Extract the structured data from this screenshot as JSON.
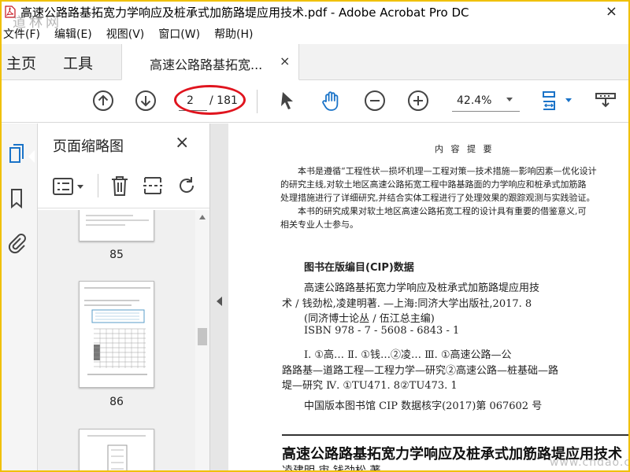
{
  "window": {
    "title": "高速公路路基拓宽力学响应及桩承式加筋路堤应用技术.pdf - Adobe Acrobat Pro DC",
    "close_glyph": "×",
    "watermark_top": "道林网",
    "watermark_bottom": "www.cndao.com"
  },
  "menu": [
    "文件(F)",
    "编辑(E)",
    "视图(V)",
    "窗口(W)",
    "帮助(H)"
  ],
  "tabs": {
    "home": "主页",
    "tools": "工具",
    "document": "高速公路路基拓宽...",
    "close": "×"
  },
  "toolbar": {
    "current_page": "2",
    "total_pages": "/ 181",
    "zoom": "42.4%",
    "highlight_color": "#e0141e",
    "accent_color": "#1a73c8"
  },
  "panel": {
    "title": "页面缩略图",
    "close": "×",
    "thumbnails": [
      {
        "label": "85"
      },
      {
        "label": "86"
      },
      {
        "label": ""
      }
    ]
  },
  "doc": {
    "heading": "内 容 提 要",
    "para1_lines": [
      "本书是遵循“工程性状—损坏机理—工程对策—技术措施—影响因素—优化设计",
      "的研究主线,对软土地区高速公路拓宽工程中路基路面的力学响应和桩承式加筋路",
      "处理措施进行了详细研究,并结合实体工程进行了处理效果的跟踪观测与实践验证。"
    ],
    "para2_lines": [
      "本书的研究成果对软土地区高速公路拓宽工程的设计具有重要的借鉴意义,可",
      "相关专业人士参与。"
    ],
    "cip_title": "图书在版编目(CIP)数据",
    "cip_lines": [
      "高速公路路基拓宽力学响应及桩承式加筋路堤应用技",
      "术 / 钱劲松,凌建明著. —上海:同济大学出版社,2017. 8",
      "(同济博士论丛 / 伍江总主编)",
      "ISBN 978 - 7 - 5608 - 6843 - 1"
    ],
    "classification_lines": [
      "Ⅰ. ①高…  Ⅱ. ①钱…②凌…  Ⅲ. ①高速公路—公",
      "路路基—道路工程—工程力学—研究②高速公路—桩基础—路",
      "堤—研究  Ⅳ. ①TU471. 8②TU473. 1"
    ],
    "cip_number": "中国版本图书馆 CIP 数据核字(2017)第 067602 号",
    "big_title": "高速公路路基拓宽力学响应及桩承式加筋路堤应用技术",
    "authors": "凌建明  审   钱劲松   著"
  }
}
